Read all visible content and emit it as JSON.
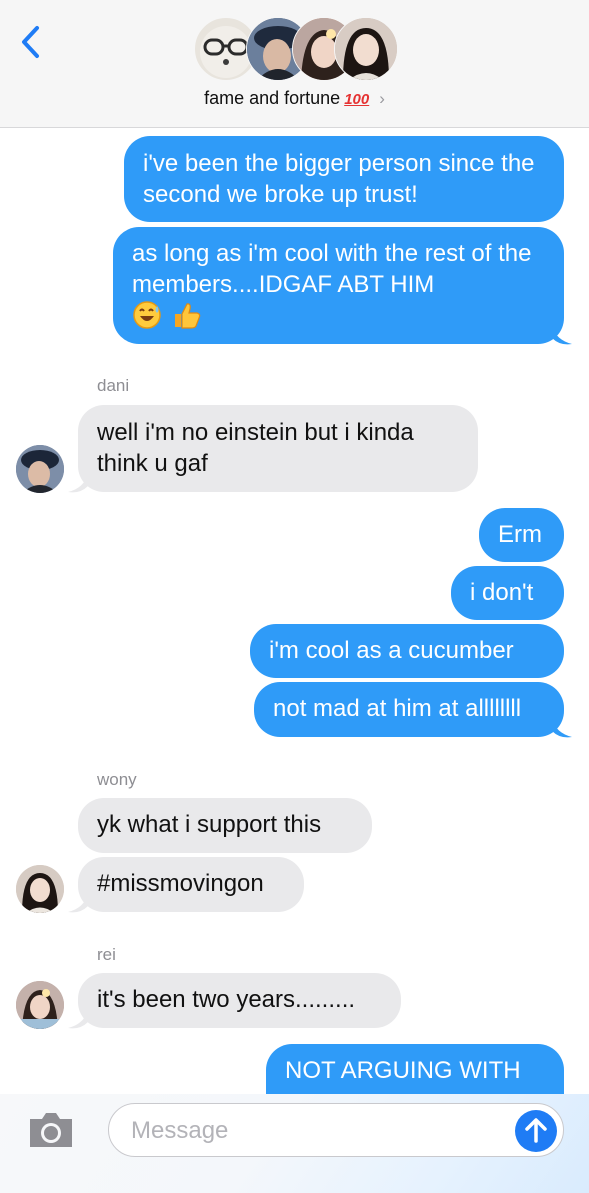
{
  "header": {
    "group_name": "fame and fortune",
    "group_emoji": "100",
    "back_icon": "chevron-left-icon",
    "disclosure_icon": "chevron-right-icon",
    "accent": "#1f7cf5"
  },
  "messages": [
    {
      "from": "me",
      "text": "i've been the bigger person since the second we broke up trust!"
    },
    {
      "from": "me",
      "text": "as long as i'm cool with the rest of the members....IDGAF ABT HIM",
      "emojis": [
        "sweat-smile",
        "thumbs-up"
      ]
    },
    {
      "sender": "dani",
      "text": "well i'm no einstein but i kinda think u gaf"
    },
    {
      "from": "me",
      "text": "Erm"
    },
    {
      "from": "me",
      "text": "i don't"
    },
    {
      "from": "me",
      "text": "i'm cool as a cucumber"
    },
    {
      "from": "me",
      "text": "not mad at him at allllllll"
    },
    {
      "sender": "wony",
      "text": "yk what i support this"
    },
    {
      "sender": "wony",
      "text": "#missmovingon"
    },
    {
      "sender": "rei",
      "text": "it's been two years........."
    },
    {
      "from": "me",
      "text": "NOT ARGUING WITH"
    }
  ],
  "input": {
    "placeholder": "Message",
    "camera_icon": "camera-icon",
    "send_icon": "arrow-up-icon"
  },
  "colors": {
    "outgoing_bubble": "#2f9bf8",
    "incoming_bubble": "#e9e9eb",
    "sender_label": "#8e8e93"
  }
}
